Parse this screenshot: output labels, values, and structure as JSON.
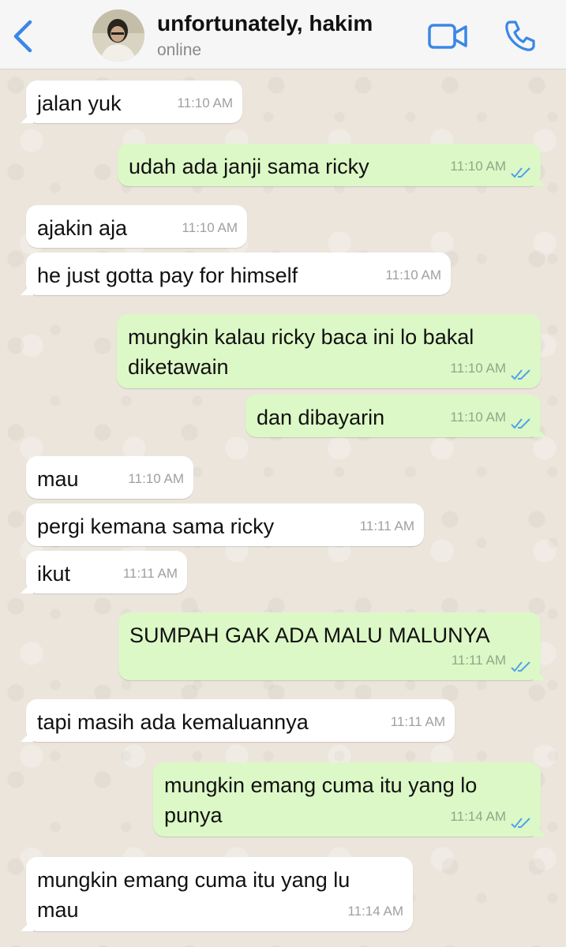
{
  "header": {
    "back_icon": "chevron-left-icon",
    "contact_name": "unfortunately, hakim",
    "status": "online",
    "video_icon": "video-camera-icon",
    "call_icon": "phone-icon",
    "accent_color": "#3a87e6"
  },
  "messages": [
    {
      "direction": "incoming",
      "text": "jalan yuk",
      "time": "11:10 AM"
    },
    {
      "direction": "outgoing",
      "text": "udah ada janji sama ricky",
      "time": "11:10 AM",
      "read": true
    },
    {
      "direction": "incoming",
      "text": "ajakin aja",
      "time": "11:10 AM"
    },
    {
      "direction": "incoming",
      "text": "he just gotta pay for himself",
      "time": "11:10 AM"
    },
    {
      "direction": "outgoing",
      "text": "mungkin kalau ricky baca ini lo bakal diketawain",
      "lines": [
        "mungkin kalau ricky baca ini lo bakal",
        "diketawain"
      ],
      "time": "11:10 AM",
      "read": true
    },
    {
      "direction": "outgoing",
      "text": "dan dibayarin",
      "time": "11:10 AM",
      "read": true
    },
    {
      "direction": "incoming",
      "text": "mau",
      "time": "11:10 AM"
    },
    {
      "direction": "incoming",
      "text": "pergi kemana sama ricky",
      "time": "11:11 AM"
    },
    {
      "direction": "incoming",
      "text": "ikut",
      "time": "11:11 AM"
    },
    {
      "direction": "outgoing",
      "text": "SUMPAH GAK ADA MALU MALUNYA",
      "time": "11:11 AM",
      "read": true
    },
    {
      "direction": "incoming",
      "text": "tapi masih ada kemaluannya",
      "time": "11:11 AM"
    },
    {
      "direction": "outgoing",
      "text": "mungkin emang cuma itu yang lo punya",
      "lines": [
        "mungkin emang cuma itu yang lo",
        "punya"
      ],
      "time": "11:14 AM",
      "read": true
    },
    {
      "direction": "incoming",
      "text": "mungkin emang cuma itu yang lu mau",
      "lines": [
        "mungkin emang cuma itu yang lu",
        "mau"
      ],
      "time": "11:14 AM"
    }
  ]
}
